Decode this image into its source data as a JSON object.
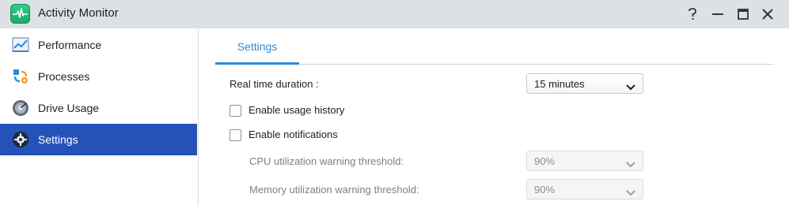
{
  "window": {
    "title": "Activity Monitor",
    "controls": [
      "help-icon",
      "minimize-icon",
      "maximize-icon",
      "close-icon"
    ]
  },
  "sidebar": {
    "items": [
      {
        "label": "Performance",
        "icon": "performance-chart-icon",
        "active": false
      },
      {
        "label": "Processes",
        "icon": "processes-icon",
        "active": false
      },
      {
        "label": "Drive Usage",
        "icon": "drive-usage-icon",
        "active": false
      },
      {
        "label": "Settings",
        "icon": "gear-icon",
        "active": true
      }
    ]
  },
  "main": {
    "tabs": [
      {
        "label": "Settings",
        "active": true
      }
    ],
    "real_time": {
      "label": "Real time duration :",
      "value": "15 minutes"
    },
    "usage_history": {
      "label": "Enable usage history",
      "checked": false
    },
    "notifications": {
      "label": "Enable notifications",
      "checked": false
    },
    "cpu_threshold": {
      "label": "CPU utilization warning threshold:",
      "value": "90%",
      "disabled": true
    },
    "memory_threshold": {
      "label": "Memory utilization warning threshold:",
      "value": "90%",
      "disabled": true
    }
  },
  "colors": {
    "accent": "#2d8ad8",
    "sidebar_active": "#2452b8",
    "titlebar": "#dde1e6"
  }
}
